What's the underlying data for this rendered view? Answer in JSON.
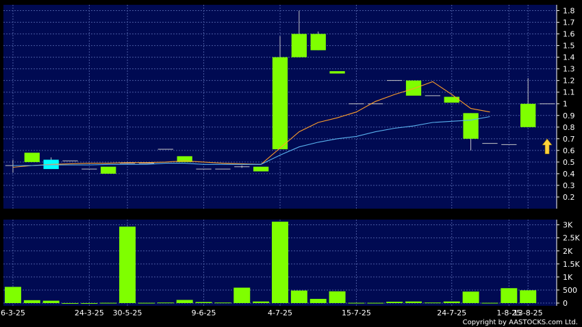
{
  "chart_data": {
    "type": "candlestick",
    "x_labels": [
      {
        "index": 0,
        "label": "6-3-25"
      },
      {
        "index": 4,
        "label": "24-3-25"
      },
      {
        "index": 6,
        "label": "30-5-25"
      },
      {
        "index": 10,
        "label": "9-6-25"
      },
      {
        "index": 14,
        "label": "4-7-25"
      },
      {
        "index": 18,
        "label": "15-7-25"
      },
      {
        "index": 23,
        "label": "24-7-25"
      },
      {
        "index": 26,
        "label": "1-8-25"
      },
      {
        "index": 27,
        "label": "13-8-25"
      }
    ],
    "price_axis": {
      "ylim": [
        0.1,
        1.85
      ],
      "ticks": [
        0.2,
        0.3,
        0.4,
        0.5,
        0.6,
        0.7,
        0.8,
        0.9,
        1,
        1.1,
        1.2,
        1.3,
        1.4,
        1.5,
        1.6,
        1.7,
        1.8
      ],
      "tick_labels": [
        "0.2",
        "0.3",
        "0.4",
        "0.5",
        "0.6",
        "0.7",
        "0.8",
        "0.9",
        "1",
        "1.1",
        "1.2",
        "1.3",
        "1.4",
        "1.5",
        "1.6",
        "1.7",
        "1.8"
      ]
    },
    "volume_axis": {
      "ylim": [
        0,
        3200
      ],
      "ticks": [
        0,
        500,
        1000,
        1500,
        2000,
        2500,
        3000
      ],
      "tick_labels": [
        "0",
        "500",
        "1K",
        "1.5K",
        "2K",
        "2.5K",
        "3K"
      ]
    },
    "candles": [
      {
        "o": 0.47,
        "h": 0.52,
        "l": 0.41,
        "c": 0.47
      },
      {
        "o": 0.5,
        "h": 0.58,
        "l": 0.5,
        "c": 0.58
      },
      {
        "o": 0.52,
        "h": 0.54,
        "l": 0.44,
        "c": 0.44
      },
      {
        "o": 0.51,
        "h": 0.51,
        "l": 0.51,
        "c": 0.51
      },
      {
        "o": 0.44,
        "h": 0.44,
        "l": 0.44,
        "c": 0.44
      },
      {
        "o": 0.4,
        "h": 0.46,
        "l": 0.4,
        "c": 0.46
      },
      {
        "o": 0.49,
        "h": 0.49,
        "l": 0.49,
        "c": 0.49
      },
      {
        "o": 0.49,
        "h": 0.49,
        "l": 0.49,
        "c": 0.49
      },
      {
        "o": 0.61,
        "h": 0.61,
        "l": 0.61,
        "c": 0.61
      },
      {
        "o": 0.5,
        "h": 0.55,
        "l": 0.5,
        "c": 0.55
      },
      {
        "o": 0.44,
        "h": 0.44,
        "l": 0.44,
        "c": 0.44
      },
      {
        "o": 0.44,
        "h": 0.44,
        "l": 0.44,
        "c": 0.44
      },
      {
        "o": 0.45,
        "h": 0.47,
        "l": 0.45,
        "c": 0.46
      },
      {
        "o": 0.42,
        "h": 0.46,
        "l": 0.42,
        "c": 0.46
      },
      {
        "o": 0.61,
        "h": 1.58,
        "l": 0.61,
        "c": 1.4
      },
      {
        "o": 1.4,
        "h": 1.8,
        "l": 1.4,
        "c": 1.6
      },
      {
        "o": 1.46,
        "h": 1.62,
        "l": 1.46,
        "c": 1.6
      },
      {
        "o": 1.26,
        "h": 1.28,
        "l": 1.26,
        "c": 1.28
      },
      {
        "o": 1.0,
        "h": 1.0,
        "l": 1.0,
        "c": 1.0
      },
      {
        "o": 1.0,
        "h": 1.0,
        "l": 1.0,
        "c": 1.0
      },
      {
        "o": 1.2,
        "h": 1.2,
        "l": 1.2,
        "c": 1.2
      },
      {
        "o": 1.07,
        "h": 1.2,
        "l": 1.07,
        "c": 1.2
      },
      {
        "o": 1.07,
        "h": 1.07,
        "l": 1.07,
        "c": 1.07
      },
      {
        "o": 1.01,
        "h": 1.06,
        "l": 1.01,
        "c": 1.06
      },
      {
        "o": 0.7,
        "h": 0.92,
        "l": 0.6,
        "c": 0.92
      },
      {
        "o": 0.66,
        "h": 0.66,
        "l": 0.66,
        "c": 0.66
      },
      {
        "o": 0.65,
        "h": 0.65,
        "l": 0.65,
        "c": 0.65
      },
      {
        "o": 0.8,
        "h": 1.22,
        "l": 0.8,
        "c": 1.0
      },
      {
        "o": 1.0,
        "h": 1.0,
        "l": 1.0,
        "c": 1.0
      }
    ],
    "ma_short": [
      0.455,
      0.47,
      0.48,
      0.485,
      0.49,
      0.49,
      0.495,
      0.495,
      0.5,
      0.51,
      0.5,
      0.49,
      0.485,
      0.48,
      0.62,
      0.76,
      0.84,
      0.88,
      0.93,
      1.02,
      1.08,
      1.13,
      1.19,
      1.08,
      0.96,
      0.93
    ],
    "ma_short_start": 0,
    "ma_long": [
      0.47,
      0.47,
      0.475,
      0.475,
      0.475,
      0.48,
      0.48,
      0.48,
      0.49,
      0.49,
      0.48,
      0.48,
      0.48,
      0.48,
      0.56,
      0.63,
      0.67,
      0.7,
      0.72,
      0.76,
      0.79,
      0.81,
      0.84,
      0.85,
      0.86,
      0.89
    ],
    "ma_long_start": 0,
    "volumes": [
      620,
      110,
      90,
      0,
      0,
      10,
      2930,
      10,
      20,
      120,
      40,
      20,
      590,
      60,
      3120,
      480,
      160,
      450,
      10,
      10,
      50,
      60,
      20,
      60,
      440,
      10,
      570,
      490
    ],
    "arrow_at_index": 28,
    "colors": {
      "background": "#000000",
      "plot_bg": "#000a52",
      "grid": "#4a5ba3",
      "up": "#7fff00",
      "down": "#00ffff",
      "ma_short": "#ff9f2a",
      "ma_long": "#5ab3f0",
      "arrow": "#ffd23a",
      "text": "#ffffff"
    }
  },
  "footer": {
    "copyright": "Copyright by AASTOCKS.com Ltd."
  }
}
